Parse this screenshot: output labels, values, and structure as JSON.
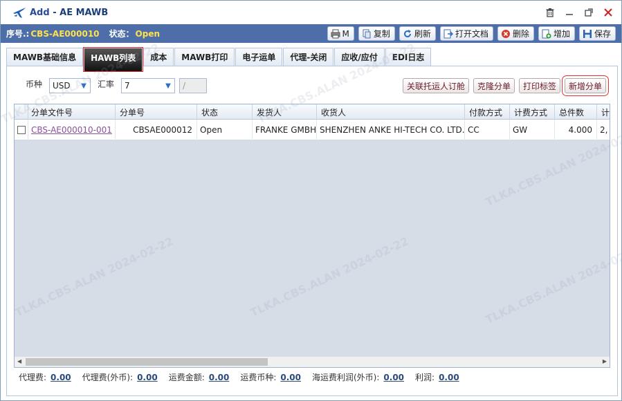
{
  "window": {
    "title_add": "Add",
    "title_sep": " - ",
    "title_name": "AE MAWB"
  },
  "infobar": {
    "serial_label": "序号.:",
    "serial_value": "CBS-AE000010",
    "status_label": "状态：",
    "status_value": "Open"
  },
  "toolbar": {
    "print_label": "M",
    "copy_label": "复制",
    "refresh_label": "刷新",
    "open_doc_label": "打开文档",
    "delete_label": "删除",
    "add_label": "增加",
    "save_label": "保存"
  },
  "tabs": [
    {
      "label": "MAWB基础信息"
    },
    {
      "label": "HAWB列表"
    },
    {
      "label": "成本"
    },
    {
      "label": "MAWB打印"
    },
    {
      "label": "电子运单"
    },
    {
      "label": "代理-关闭"
    },
    {
      "label": "应收/应付"
    },
    {
      "label": "EDI日志"
    }
  ],
  "filters": {
    "currency_label": "币种",
    "currency_value": "USD",
    "rate_label": "汇率",
    "rate_value": "7",
    "rate_ext": "/"
  },
  "actions": {
    "link_shipper": "关联托运人订舱",
    "clone": "克隆分单",
    "print_label": "打印标签",
    "new_hawb": "新增分单"
  },
  "grid": {
    "headers": [
      "分单文件号",
      "分单号",
      "状态",
      "发货人",
      "收货人",
      "付款方式",
      "计费方式",
      "总件数",
      "计"
    ],
    "rows": [
      {
        "file_no": "CBS-AE000010-001",
        "hawb_no": "CBSAE000012",
        "status": "Open",
        "shipper": "FRANKE GMBH",
        "consignee": "SHENZHEN ANKE HI-TECH CO. LTD.",
        "payment": "CC",
        "charge_method": "GW",
        "pieces": "4.000",
        "more": "2,"
      }
    ]
  },
  "footer": {
    "agent_fee_label": "代理费:",
    "agent_fee_value": "0.00",
    "agent_fee_fc_label": "代理费(外币):",
    "agent_fee_fc_value": "0.00",
    "freight_amount_label": "运费金额:",
    "freight_amount_value": "0.00",
    "freight_currency_label": "运费币种:",
    "freight_currency_value": "0.00",
    "sea_profit_label": "海运费利润(外币):",
    "sea_profit_value": "0.00",
    "profit_label": "利润:",
    "profit_value": "0.00"
  },
  "watermark": "TLKA.CBS.ALAN 2024-02-22",
  "colors": {
    "infobar": "#4d6ea8",
    "highlight_value": "#ffe14d",
    "active_tab": "#111111",
    "annotation_red": "#e23232"
  }
}
